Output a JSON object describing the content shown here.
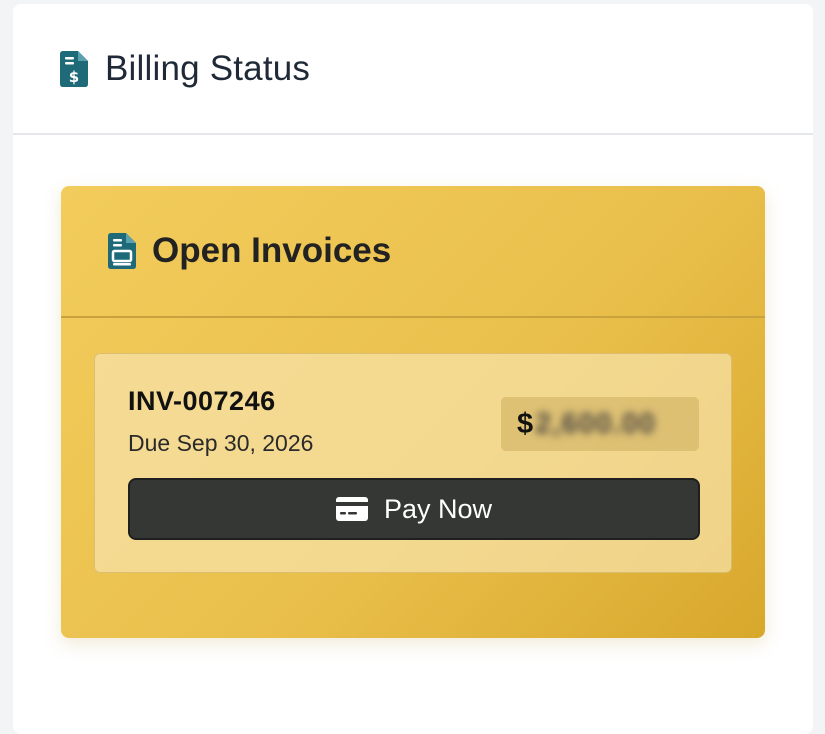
{
  "header": {
    "title": "Billing Status",
    "icon": "file-invoice-dollar-icon"
  },
  "panel": {
    "title": "Open Invoices",
    "icon": "file-invoice-icon"
  },
  "invoices": [
    {
      "number": "INV-007246",
      "due": "Due Sep 30, 2026",
      "currency_symbol": "$",
      "amount": "2,600.00",
      "pay_label": "Pay Now",
      "pay_icon": "credit-card-icon"
    }
  ],
  "colors": {
    "accent_teal": "#1f6a78",
    "panel_gold": "#eac04c",
    "button_dark": "#343734"
  }
}
